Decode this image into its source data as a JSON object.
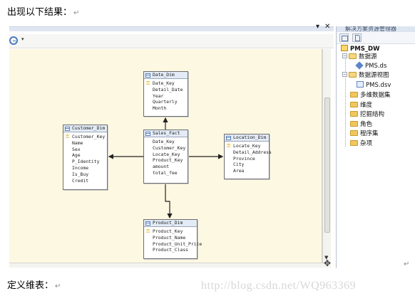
{
  "document": {
    "line1": "出现以下结果：",
    "line2": "定义维表：",
    "return_mark": "↵",
    "watermark": "http://blog.csdn.net/WQ963369"
  },
  "window": {
    "pin_glyph": "▾",
    "close_glyph": "✕",
    "zoom_dropdown": "▾"
  },
  "diagram": {
    "tables": {
      "date_dim": {
        "name": "Date_Dim",
        "fields": [
          "Date_Key",
          "Detail_Date",
          "Year",
          "Quarterly",
          "Month"
        ],
        "key_fields": [
          0
        ]
      },
      "customer_dim": {
        "name": "Customer_Dim",
        "fields": [
          "Customer_Key",
          "Name",
          "Sex",
          "Age",
          "P_Identity",
          "Income",
          "Is_Buy",
          "Credit"
        ],
        "key_fields": [
          0
        ]
      },
      "sales_fact": {
        "name": "Sales_Fact",
        "fields": [
          "Date_Key",
          "Customer_Key",
          "Locate_Key",
          "Product_Key",
          "amount",
          "total_fee"
        ],
        "key_fields": []
      },
      "location_dim": {
        "name": "Location_Dim",
        "fields": [
          "Locate_Key",
          "Detail_Address",
          "Province",
          "City",
          "Area"
        ],
        "key_fields": [
          0
        ]
      },
      "product_dim": {
        "name": "Product_Dim",
        "fields": [
          "Product_Key",
          "Product_Name",
          "Product_Unit_Price",
          "Product_Class"
        ],
        "key_fields": [
          0
        ]
      }
    }
  },
  "solution_explorer": {
    "title": "解决方案资源管理器",
    "project": "PMS_DW",
    "nodes": [
      {
        "label": "数据源",
        "type": "folder",
        "expanded": true
      },
      {
        "label": "PMS.ds",
        "type": "datasource"
      },
      {
        "label": "数据源视图",
        "type": "folder",
        "expanded": true
      },
      {
        "label": "PMS.dsv",
        "type": "dsv"
      },
      {
        "label": "多维数据集",
        "type": "folder"
      },
      {
        "label": "维度",
        "type": "folder"
      },
      {
        "label": "挖掘结构",
        "type": "folder"
      },
      {
        "label": "角色",
        "type": "folder"
      },
      {
        "label": "程序集",
        "type": "folder"
      },
      {
        "label": "杂项",
        "type": "folder"
      }
    ]
  }
}
